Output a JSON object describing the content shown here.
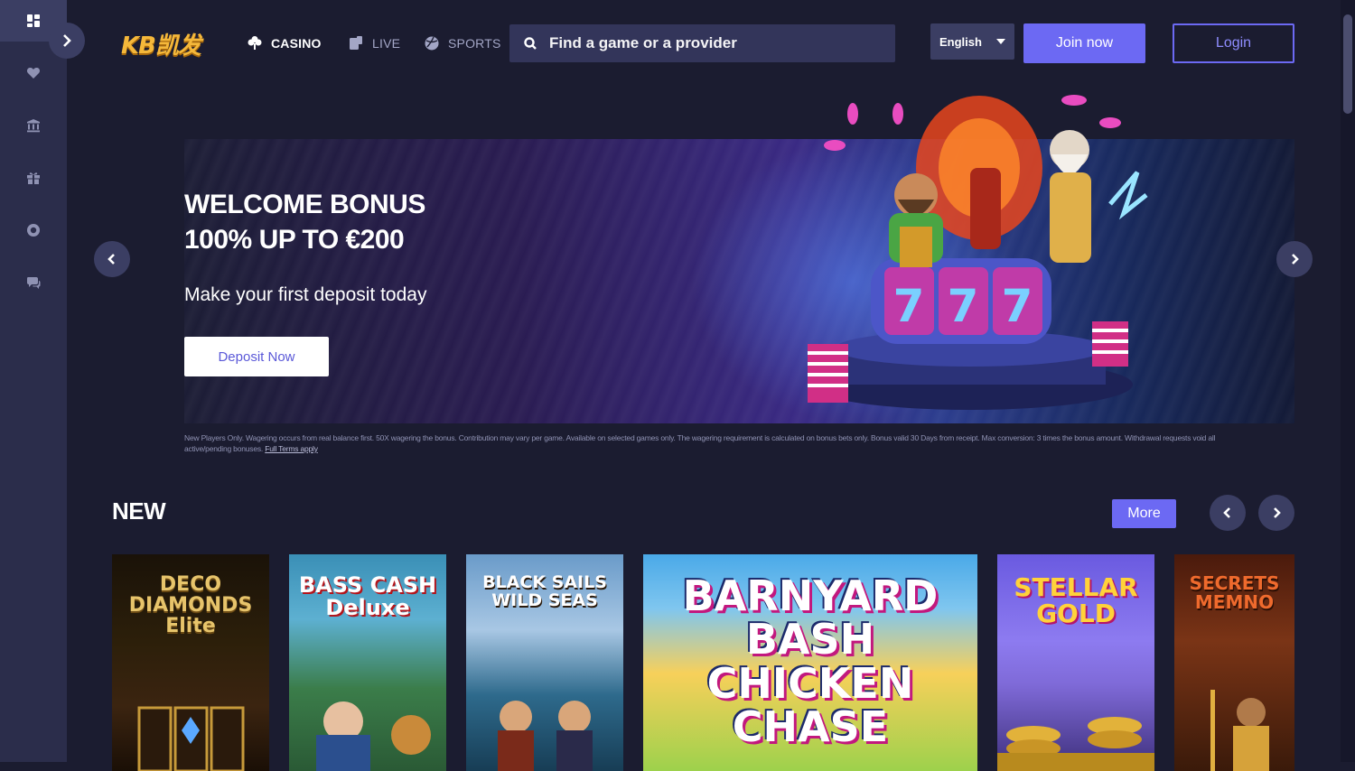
{
  "colors": {
    "background": "#1b1c30",
    "sidebar": "#2b2d4b",
    "accent": "#6c69f3",
    "logo": "#f5b83a"
  },
  "sidebar": {
    "items": [
      {
        "icon": "grid-icon",
        "active": true
      },
      {
        "icon": "heart-icon"
      },
      {
        "icon": "bank-icon"
      },
      {
        "icon": "gift-icon"
      },
      {
        "icon": "lifebuoy-icon"
      },
      {
        "icon": "chat-icon"
      }
    ]
  },
  "header": {
    "logo": "KB凯发",
    "nav": {
      "casino": "CASINO",
      "live": "LIVE",
      "sports": "SPORTS"
    },
    "search": {
      "placeholder": "Find a game or a provider"
    },
    "language": "English",
    "join_label": "Join now",
    "login_label": "Login"
  },
  "banner": {
    "title_line1": "WELCOME BONUS",
    "title_line2": "100% UP TO €200",
    "subtitle": "Make your first deposit today",
    "cta": "Deposit Now",
    "terms": "New Players Only. Wagering occurs from real balance first. 50X wagering the bonus. Contribution may vary per game. Available on selected games only. The wagering requirement is calculated on bonus bets only. Bonus valid 30 Days from receipt. Max conversion: 3 times the bonus amount. Withdrawal requests void all active/pending bonuses.",
    "terms_link": "Full Terms apply"
  },
  "new_section": {
    "title": "NEW",
    "more_label": "More",
    "games": [
      {
        "name": "DECO DIAMONDS Elite"
      },
      {
        "name": "BASS CASH Deluxe"
      },
      {
        "name": "BLACK SAILS WILD SEAS"
      },
      {
        "name": "BARNYARD BASH CHICKEN CHASE"
      },
      {
        "name": "STELLAR GOLD"
      },
      {
        "name": "SECRETS MEMNO"
      }
    ]
  }
}
